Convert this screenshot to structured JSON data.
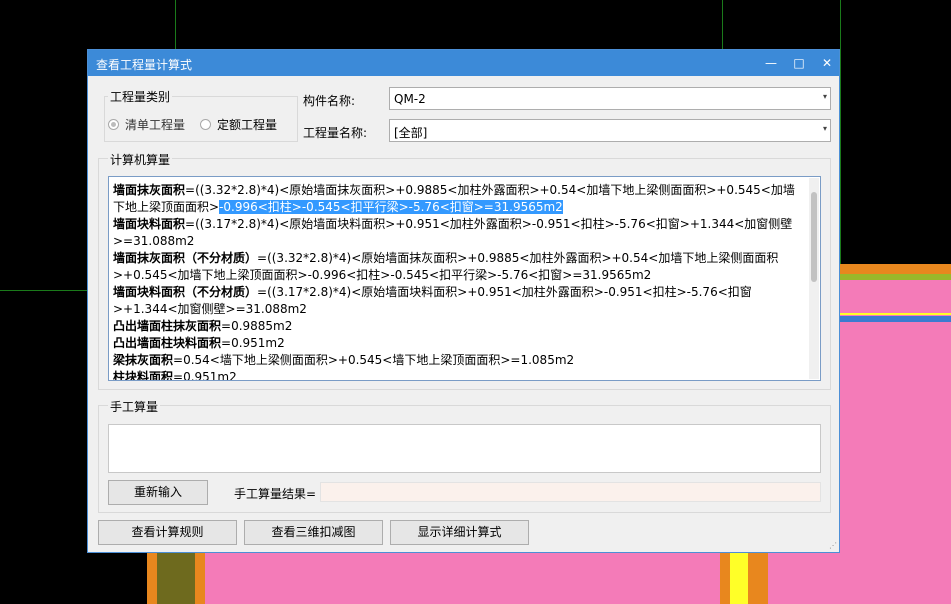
{
  "dialog": {
    "title": "查看工程量计算式",
    "minimize_icon": "minimize-icon",
    "maximize_icon": "maximize-icon",
    "close_icon": "close-icon",
    "minimize_glyph": "—",
    "maximize_glyph": "□",
    "close_glyph": "✕"
  },
  "quantity_type": {
    "group_label": "工程量类别",
    "options": [
      {
        "label": "清单工程量",
        "selected": true
      },
      {
        "label": "定额工程量",
        "selected": false
      }
    ]
  },
  "component": {
    "name_label": "构件名称:",
    "name_value": "QM-2",
    "quantity_name_label": "工程量名称:",
    "quantity_name_value": "[全部]",
    "dropdown_glyph": "▾"
  },
  "computer_calc": {
    "group_label": "计算机算量",
    "lines": [
      {
        "name": "墙面抹灰面积",
        "formula_pre": "=((3.32*2.8)*4)<原始墙面抹灰面积>+0.9885<加柱外露面积>+0.54<加墙下地上梁侧面面积>+0.545<加墙下地上梁顶面面积>",
        "formula_sel": "-0.996<扣柱>-0.545<扣平行梁>-5.76<扣窗>=31.9565m2"
      },
      {
        "name": "墙面块料面积",
        "formula": "=((3.17*2.8)*4)<原始墙面块料面积>+0.951<加柱外露面积>-0.951<扣柱>-5.76<扣窗>+1.344<加窗侧壁>=31.088m2"
      },
      {
        "name": "墙面抹灰面积（不分材质）",
        "formula": "=((3.32*2.8)*4)<原始墙面抹灰面积>+0.9885<加柱外露面积>+0.54<加墙下地上梁侧面面积>+0.545<加墙下地上梁顶面面积>-0.996<扣柱>-0.545<扣平行梁>-5.76<扣窗>=31.9565m2"
      },
      {
        "name": "墙面块料面积（不分材质）",
        "formula": "=((3.17*2.8)*4)<原始墙面块料面积>+0.951<加柱外露面积>-0.951<扣柱>-5.76<扣窗>+1.344<加窗侧壁>=31.088m2"
      },
      {
        "name": "凸出墙面柱抹灰面积",
        "formula": "=0.9885m2"
      },
      {
        "name": "凸出墙面柱块料面积",
        "formula": "=0.951m2"
      },
      {
        "name": "梁抹灰面积",
        "formula": "=0.54<墙下地上梁侧面面积>+0.545<墙下地上梁顶面面积>=1.085m2"
      },
      {
        "name": "柱块料面积",
        "formula": "=0.951m2"
      }
    ]
  },
  "manual_calc": {
    "group_label": "手工算量",
    "reenter_button": "重新输入",
    "result_label": "手工算量结果="
  },
  "footer": {
    "buttons": [
      "查看计算规则",
      "查看三维扣减图",
      "显示详细计算式"
    ]
  }
}
